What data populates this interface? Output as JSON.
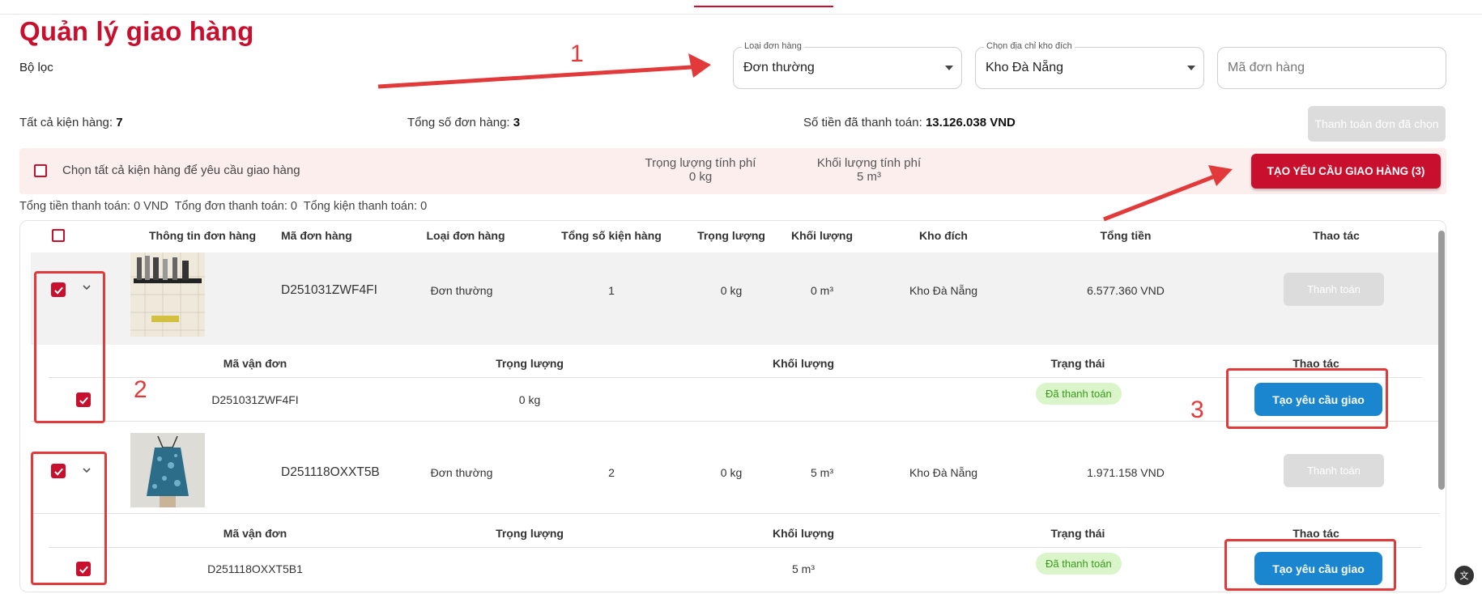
{
  "page": {
    "title": "Quản lý giao hàng",
    "filter_label": "Bộ lọc"
  },
  "filters": {
    "order_type": {
      "label": "Loại đơn hàng",
      "value": "Đơn thường"
    },
    "warehouse": {
      "label": "Chọn địa chỉ kho đích",
      "value": "Kho Đà Nẵng"
    },
    "order_code": {
      "placeholder": "Mã đơn hàng"
    }
  },
  "stats": {
    "all_packages_label": "Tất cả kiện hàng:",
    "all_packages": "7",
    "total_orders_label": "Tổng số đơn hàng:",
    "total_orders": "3",
    "paid_label": "Số tiền đã thanh toán:",
    "paid": "13.126.038 VND",
    "pay_selected_button": "Thanh toán đơn đã chọn"
  },
  "select_bar": {
    "select_all_label": "Chọn tất cả kiện hàng để yêu cầu giao hàng",
    "charge_weight_label": "Trọng lượng tính phí",
    "charge_weight": "0 kg",
    "charge_volume_label": "Khối lượng tính phí",
    "charge_volume": "5 m³",
    "create_request_button": "TẠO YÊU CẦU GIAO HÀNG (3)"
  },
  "summary": "Tổng tiền thanh toán: 0 VND  Tổng đơn thanh toán: 0  Tổng kiện thanh toán: 0",
  "table": {
    "headers": [
      "Thông tin đơn hàng",
      "Mã đơn hàng",
      "Loại đơn hàng",
      "Tổng số kiện hàng",
      "Trọng lượng",
      "Khối lượng",
      "Kho đích",
      "Tổng tiền",
      "Thao tác"
    ],
    "sub_headers": [
      "Mã vận đơn",
      "Trọng lượng",
      "Khối lượng",
      "Trạng thái",
      "Thao tác"
    ],
    "orders": [
      {
        "code": "D251031ZWF4FI",
        "type": "Đơn thường",
        "packages": "1",
        "weight": "0 kg",
        "volume": "0 m³",
        "warehouse": "Kho Đà Nẵng",
        "total": "6.577.360 VND",
        "action": "Thanh toán",
        "shipment": {
          "code": "D251031ZWF4FI",
          "weight": "0 kg",
          "volume": "",
          "status": "Đã thanh toán",
          "action": "Tạo yêu cầu giao"
        }
      },
      {
        "code": "D251118OXXT5B",
        "type": "Đơn thường",
        "packages": "2",
        "weight": "0 kg",
        "volume": "5 m³",
        "warehouse": "Kho Đà Nẵng",
        "total": "1.971.158 VND",
        "action": "Thanh toán",
        "shipment": {
          "code": "D251118OXXT5B1",
          "weight": "",
          "volume": "5 m³",
          "status": "Đã thanh toán",
          "action": "Tạo yêu cầu giao"
        }
      }
    ]
  },
  "annotations": {
    "n1": "1",
    "n2": "2",
    "n3": "3"
  },
  "colors": {
    "brand": "#c8102e",
    "primary_button": "#1a86cf",
    "status_paid_bg": "#d9f5c9",
    "annotation": "#e23a3a"
  }
}
